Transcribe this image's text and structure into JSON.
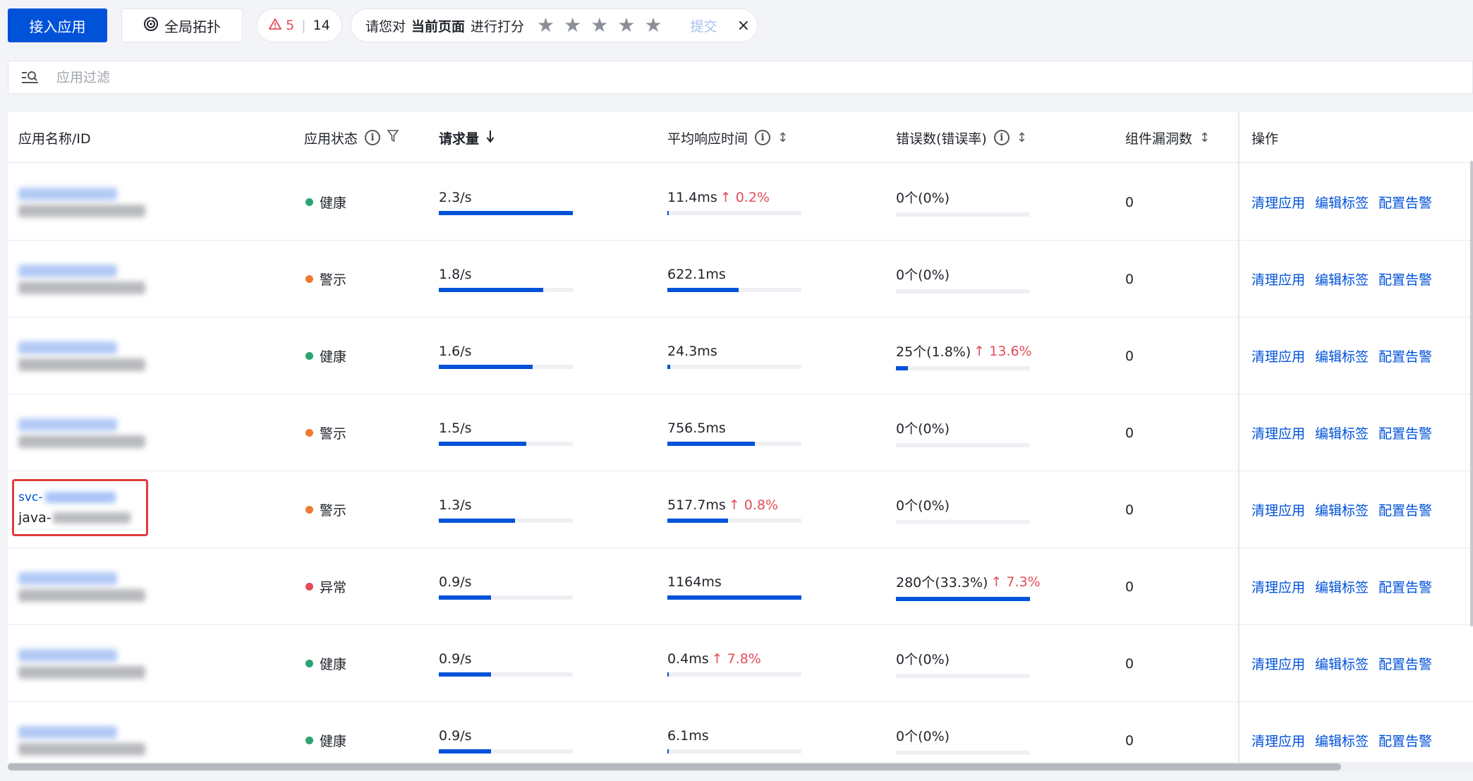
{
  "toolbar": {
    "connect_label": "接入应用",
    "topology_label": "全局拓扑",
    "alert_warn_count": "5",
    "alert_total": "14",
    "rating_prefix": "请您对",
    "rating_target": "当前页面",
    "rating_suffix": "进行打分",
    "submit_label": "提交",
    "close_glyph": "×",
    "star_glyph": "★",
    "star_count": 5
  },
  "filter": {
    "placeholder": "应用过滤"
  },
  "table": {
    "columns": {
      "name": "应用名称/ID",
      "status": "应用状态",
      "requests": "请求量",
      "latency": "平均响应时间",
      "errors": "错误数(错误率)",
      "vulns": "组件漏洞数",
      "ops": "操作"
    },
    "actions": [
      "清理应用",
      "编辑标签",
      "配置告警"
    ],
    "rows": [
      {
        "status": "健康",
        "status_color": "#2ba471",
        "req": "2.3/s",
        "req_pct": 1.0,
        "lat": "11.4ms",
        "lat_trend": "0.2%",
        "lat_pct": 0.01,
        "err": "0个(0%)",
        "err_trend": "",
        "err_pct": 0,
        "vuln": "0"
      },
      {
        "status": "警示",
        "status_color": "#ed7b2f",
        "req": "1.8/s",
        "req_pct": 0.78,
        "lat": "622.1ms",
        "lat_trend": "",
        "lat_pct": 0.53,
        "err": "0个(0%)",
        "err_trend": "",
        "err_pct": 0,
        "vuln": "0"
      },
      {
        "status": "健康",
        "status_color": "#2ba471",
        "req": "1.6/s",
        "req_pct": 0.7,
        "lat": "24.3ms",
        "lat_trend": "",
        "lat_pct": 0.02,
        "err": "25个(1.8%)",
        "err_trend": "13.6%",
        "err_pct": 0.09,
        "vuln": "0"
      },
      {
        "status": "警示",
        "status_color": "#ed7b2f",
        "req": "1.5/s",
        "req_pct": 0.65,
        "lat": "756.5ms",
        "lat_trend": "",
        "lat_pct": 0.65,
        "err": "0个(0%)",
        "err_trend": "",
        "err_pct": 0,
        "vuln": "0"
      },
      {
        "status": "警示",
        "status_color": "#ed7b2f",
        "req": "1.3/s",
        "req_pct": 0.57,
        "lat": "517.7ms",
        "lat_trend": "0.8%",
        "lat_pct": 0.45,
        "err": "0个(0%)",
        "err_trend": "",
        "err_pct": 0,
        "vuln": "0"
      },
      {
        "status": "异常",
        "status_color": "#e34d59",
        "req": "0.9/s",
        "req_pct": 0.39,
        "lat": "1164ms",
        "lat_trend": "",
        "lat_pct": 1.0,
        "err": "280个(33.3%)",
        "err_trend": "7.3%",
        "err_pct": 1.0,
        "vuln": "0"
      },
      {
        "status": "健康",
        "status_color": "#2ba471",
        "req": "0.9/s",
        "req_pct": 0.39,
        "lat": "0.4ms",
        "lat_trend": "7.8%",
        "lat_pct": 0.005,
        "err": "0个(0%)",
        "err_trend": "",
        "err_pct": 0,
        "vuln": "0"
      },
      {
        "status": "健康",
        "status_color": "#2ba471",
        "req": "0.9/s",
        "req_pct": 0.39,
        "lat": "6.1ms",
        "lat_trend": "",
        "lat_pct": 0.01,
        "err": "0个(0%)",
        "err_trend": "",
        "err_pct": 0,
        "vuln": "0"
      }
    ],
    "highlight": {
      "id_prefix": "svc-",
      "name_prefix": "java-"
    }
  },
  "trend_glyph": "↑",
  "colors": {
    "primary": "#0052d9",
    "danger": "#e34d59",
    "warning": "#ed7b2f",
    "success": "#2ba471"
  }
}
